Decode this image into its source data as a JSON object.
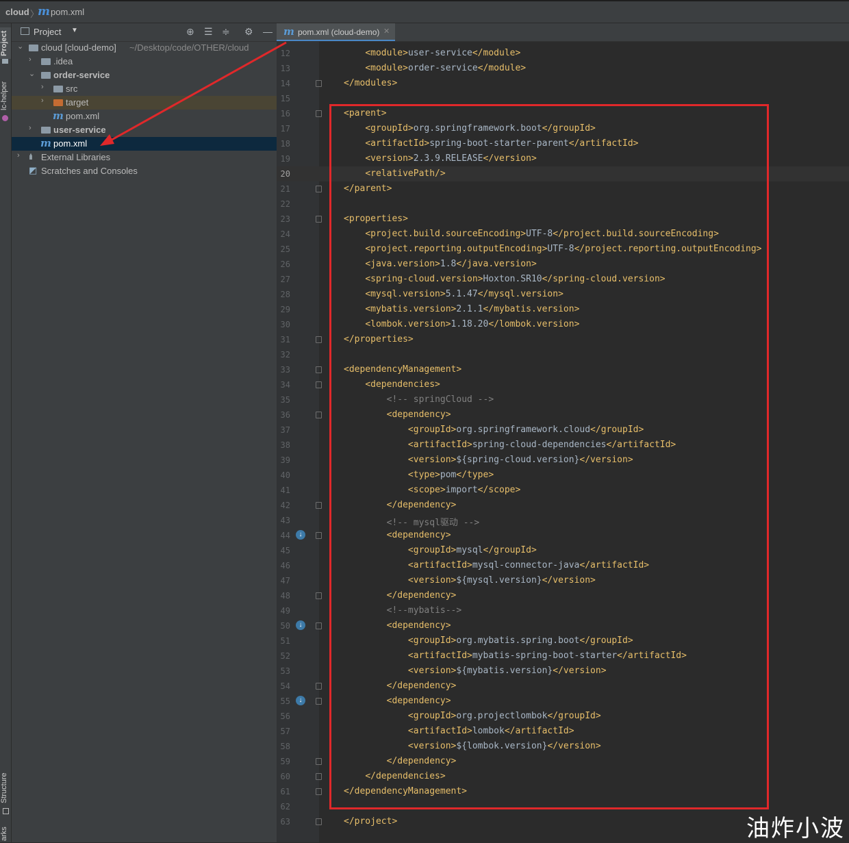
{
  "breadcrumb": {
    "root": "cloud",
    "file_icon": "m",
    "file": "pom.xml"
  },
  "left_strip": {
    "project_label": "Project",
    "helper_label": "lc-helper",
    "structure_label": "Structure",
    "bookmarks_label": "arks"
  },
  "project_panel": {
    "title": "Project",
    "tree": [
      {
        "label": "cloud [cloud-demo]",
        "path": "~/Desktop/code/OTHER/cloud"
      },
      {
        "label": ".idea"
      },
      {
        "label": "order-service"
      },
      {
        "label": "src"
      },
      {
        "label": "target"
      },
      {
        "label": "pom.xml"
      },
      {
        "label": "user-service"
      },
      {
        "label": "pom.xml"
      },
      {
        "label": "External Libraries"
      },
      {
        "label": "Scratches and Consoles"
      }
    ]
  },
  "editor": {
    "tab_label": "pom.xml (cloud-demo)",
    "current_line": "20",
    "lines": [
      {
        "n": "12",
        "code": "    <module>user-service</module>"
      },
      {
        "n": "13",
        "code": "    <module>order-service</module>"
      },
      {
        "n": "14",
        "code": "</modules>"
      },
      {
        "n": "15",
        "code": ""
      },
      {
        "n": "16",
        "code": "<parent>"
      },
      {
        "n": "17",
        "code": "    <groupId>org.springframework.boot</groupId>"
      },
      {
        "n": "18",
        "code": "    <artifactId>spring-boot-starter-parent</artifactId>"
      },
      {
        "n": "19",
        "code": "    <version>2.3.9.RELEASE</version>"
      },
      {
        "n": "20",
        "code": "    <relativePath/>"
      },
      {
        "n": "21",
        "code": "</parent>"
      },
      {
        "n": "22",
        "code": ""
      },
      {
        "n": "23",
        "code": "<properties>"
      },
      {
        "n": "24",
        "code": "    <project.build.sourceEncoding>UTF-8</project.build.sourceEncoding>"
      },
      {
        "n": "25",
        "code": "    <project.reporting.outputEncoding>UTF-8</project.reporting.outputEncoding>"
      },
      {
        "n": "26",
        "code": "    <java.version>1.8</java.version>"
      },
      {
        "n": "27",
        "code": "    <spring-cloud.version>Hoxton.SR10</spring-cloud.version>"
      },
      {
        "n": "28",
        "code": "    <mysql.version>5.1.47</mysql.version>"
      },
      {
        "n": "29",
        "code": "    <mybatis.version>2.1.1</mybatis.version>"
      },
      {
        "n": "30",
        "code": "    <lombok.version>1.18.20</lombok.version>"
      },
      {
        "n": "31",
        "code": "</properties>"
      },
      {
        "n": "32",
        "code": ""
      },
      {
        "n": "33",
        "code": "<dependencyManagement>"
      },
      {
        "n": "34",
        "code": "    <dependencies>"
      },
      {
        "n": "35",
        "code": "        <!-- springCloud -->"
      },
      {
        "n": "36",
        "code": "        <dependency>"
      },
      {
        "n": "37",
        "code": "            <groupId>org.springframework.cloud</groupId>"
      },
      {
        "n": "38",
        "code": "            <artifactId>spring-cloud-dependencies</artifactId>"
      },
      {
        "n": "39",
        "code": "            <version>${spring-cloud.version}</version>"
      },
      {
        "n": "40",
        "code": "            <type>pom</type>"
      },
      {
        "n": "41",
        "code": "            <scope>import</scope>"
      },
      {
        "n": "42",
        "code": "        </dependency>"
      },
      {
        "n": "43",
        "code": "        <!-- mysql驱动 -->"
      },
      {
        "n": "44",
        "code": "        <dependency>"
      },
      {
        "n": "45",
        "code": "            <groupId>mysql</groupId>"
      },
      {
        "n": "46",
        "code": "            <artifactId>mysql-connector-java</artifactId>"
      },
      {
        "n": "47",
        "code": "            <version>${mysql.version}</version>"
      },
      {
        "n": "48",
        "code": "        </dependency>"
      },
      {
        "n": "49",
        "code": "        <!--mybatis-->"
      },
      {
        "n": "50",
        "code": "        <dependency>"
      },
      {
        "n": "51",
        "code": "            <groupId>org.mybatis.spring.boot</groupId>"
      },
      {
        "n": "52",
        "code": "            <artifactId>mybatis-spring-boot-starter</artifactId>"
      },
      {
        "n": "53",
        "code": "            <version>${mybatis.version}</version>"
      },
      {
        "n": "54",
        "code": "        </dependency>"
      },
      {
        "n": "55",
        "code": "        <dependency>"
      },
      {
        "n": "56",
        "code": "            <groupId>org.projectlombok</groupId>"
      },
      {
        "n": "57",
        "code": "            <artifactId>lombok</artifactId>"
      },
      {
        "n": "58",
        "code": "            <version>${lombok.version}</version>"
      },
      {
        "n": "59",
        "code": "        </dependency>"
      },
      {
        "n": "60",
        "code": "    </dependencies>"
      },
      {
        "n": "61",
        "code": "</dependencyManagement>"
      },
      {
        "n": "62",
        "code": ""
      },
      {
        "n": "63",
        "code": "</project>"
      }
    ]
  },
  "watermark": "油炸小波",
  "colors": {
    "tag": "#e8bf6a",
    "text": "#a9b7c6",
    "comment": "#808080",
    "annotation": "#e0282a"
  }
}
